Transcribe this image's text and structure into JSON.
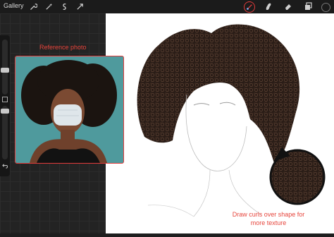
{
  "toolbar": {
    "gallery_label": "Gallery",
    "left_tools": [
      "wrench-icon",
      "magic-wand-icon",
      "selection-icon",
      "transform-icon"
    ],
    "right_tools": [
      "brush-icon",
      "smudge-icon",
      "eraser-icon",
      "layers-icon",
      "color-swatch"
    ],
    "accent_color": "#e23b3b"
  },
  "reference": {
    "label": "Reference photo"
  },
  "annotation": {
    "callout": "Draw curls over shape for more texture"
  }
}
